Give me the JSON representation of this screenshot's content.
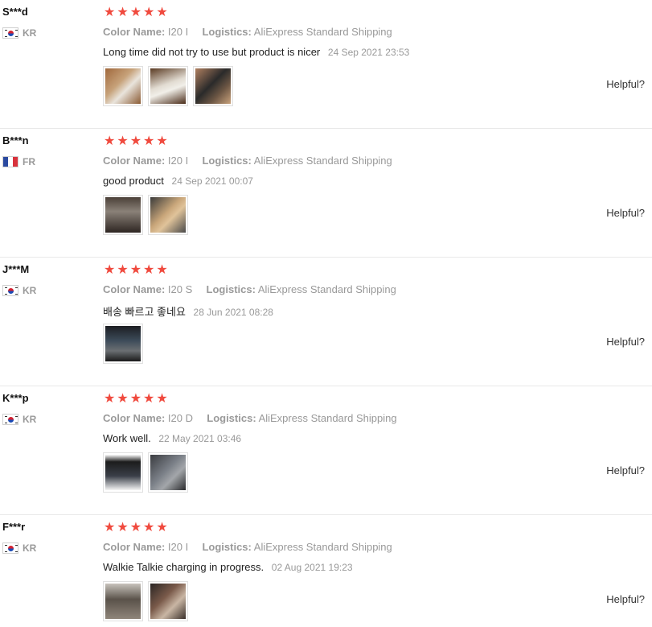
{
  "labels": {
    "color_name": "Color Name:",
    "logistics": "Logistics:",
    "helpful": "Helpful?"
  },
  "colors": {
    "star": "#f04a3e",
    "muted": "#999999",
    "divider": "#e8e8e8"
  },
  "reviews": [
    {
      "name": "S***d",
      "country": "KR",
      "rating": 5,
      "color": "I20 I",
      "shipping": "AliExpress Standard Shipping",
      "text": "Long time did not try to use but product is nicer",
      "date": "24 Sep 2021 23:53",
      "photo_count": 3
    },
    {
      "name": "B***n",
      "country": "FR",
      "rating": 5,
      "color": "I20 I",
      "shipping": "AliExpress Standard Shipping",
      "text": "good product",
      "date": "24 Sep 2021 00:07",
      "photo_count": 2
    },
    {
      "name": "J***M",
      "country": "KR",
      "rating": 5,
      "color": "I20 S",
      "shipping": "AliExpress Standard Shipping",
      "text": "배송 빠르고 좋네요",
      "date": "28 Jun 2021 08:28",
      "photo_count": 1
    },
    {
      "name": "K***p",
      "country": "KR",
      "rating": 5,
      "color": "I20 D",
      "shipping": "AliExpress Standard Shipping",
      "text": "Work well.",
      "date": "22 May 2021 03:46",
      "photo_count": 2
    },
    {
      "name": "F***r",
      "country": "KR",
      "rating": 5,
      "color": "I20 I",
      "shipping": "AliExpress Standard Shipping",
      "text": "Walkie Talkie charging in progress.",
      "date": "02 Aug 2021 19:23",
      "photo_count": 2
    }
  ]
}
